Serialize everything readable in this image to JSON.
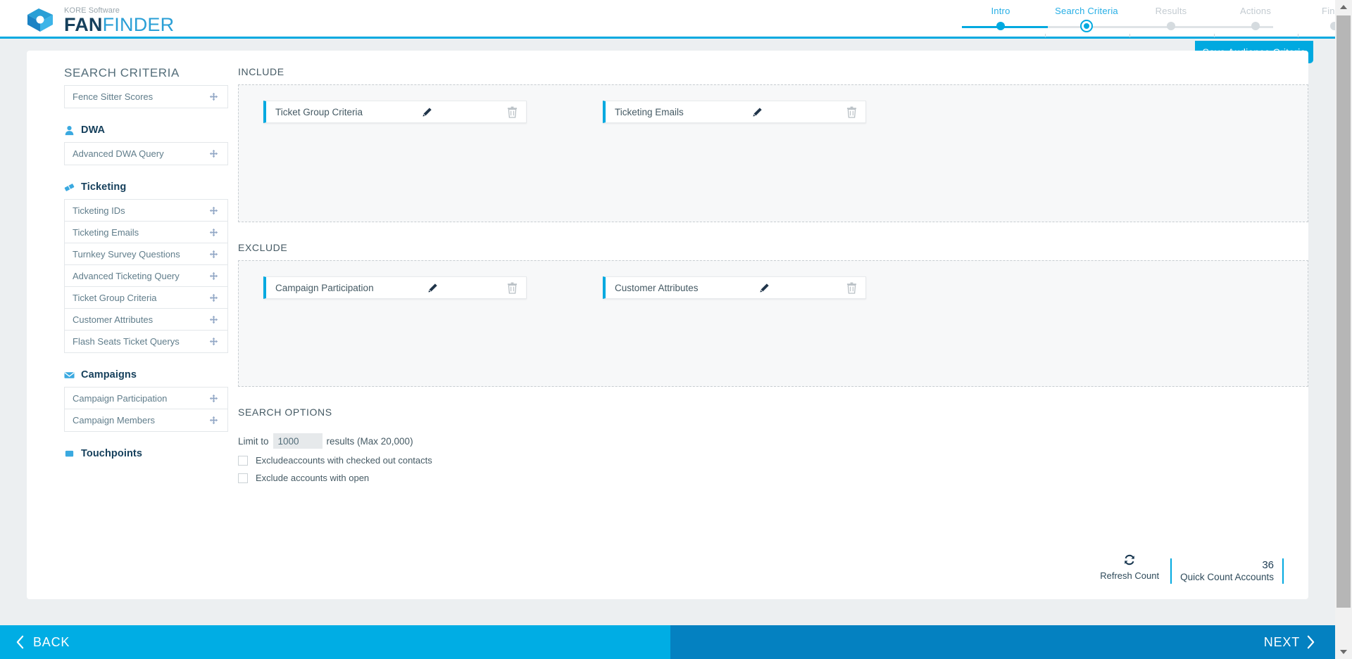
{
  "brand": {
    "sub": "KORE Software",
    "name_bold": "FAN",
    "name_light": "FINDER",
    "logo_icon": "kore-cube-logo"
  },
  "header": {
    "save_button": "Save Audience Criteria"
  },
  "stepper": {
    "steps": [
      {
        "label": "Intro",
        "state": "done"
      },
      {
        "label": "Search Criteria",
        "state": "current"
      },
      {
        "label": "Results",
        "state": "todo"
      },
      {
        "label": "Actions",
        "state": "todo"
      },
      {
        "label": "Finish",
        "state": "todo"
      }
    ],
    "accent_color": "#00a9e0",
    "inactive_color": "#d5dbdf"
  },
  "sidebar": {
    "title": "SEARCH CRITERIA",
    "groups": [
      {
        "name": "",
        "icon": "",
        "items": [
          {
            "label": "Fence Sitter Scores",
            "drag_icon": "move-arrows-icon"
          }
        ]
      },
      {
        "name": "DWA",
        "icon": "person-icon",
        "items": [
          {
            "label": "Advanced DWA Query",
            "drag_icon": "move-arrows-icon"
          }
        ]
      },
      {
        "name": "Ticketing",
        "icon": "ticket-icon",
        "items": [
          {
            "label": "Ticketing IDs",
            "drag_icon": "move-arrows-icon"
          },
          {
            "label": "Ticketing Emails",
            "drag_icon": "move-arrows-icon"
          },
          {
            "label": "Turnkey Survey Questions",
            "drag_icon": "move-arrows-icon"
          },
          {
            "label": "Advanced Ticketing Query",
            "drag_icon": "move-arrows-icon"
          },
          {
            "label": "Ticket Group Criteria",
            "drag_icon": "move-arrows-icon"
          },
          {
            "label": "Customer Attributes",
            "drag_icon": "move-arrows-icon"
          },
          {
            "label": "Flash Seats Ticket Querys",
            "drag_icon": "move-arrows-icon"
          }
        ]
      },
      {
        "name": "Campaigns",
        "icon": "envelope-icon",
        "items": [
          {
            "label": "Campaign Participation",
            "drag_icon": "move-arrows-icon"
          },
          {
            "label": "Campaign Members",
            "drag_icon": "move-arrows-icon"
          }
        ]
      },
      {
        "name": "Touchpoints",
        "icon": "touchpoint-icon",
        "items": [],
        "clipped": true
      }
    ]
  },
  "include": {
    "title": "INCLUDE",
    "chips": [
      {
        "label": "Ticket Group Criteria",
        "edit_icon": "pencil-icon",
        "delete_icon": "trash-icon"
      },
      {
        "label": "Ticketing Emails",
        "edit_icon": "pencil-icon",
        "delete_icon": "trash-icon"
      }
    ]
  },
  "exclude": {
    "title": "EXCLUDE",
    "chips": [
      {
        "label": "Campaign Participation",
        "edit_icon": "pencil-icon",
        "delete_icon": "trash-icon"
      },
      {
        "label": "Customer Attributes",
        "edit_icon": "pencil-icon",
        "delete_icon": "trash-icon"
      }
    ]
  },
  "search_options": {
    "title": "SEARCH OPTIONS",
    "limit_prefix": "Limit to",
    "limit_value": "1000",
    "limit_placeholder": "1000",
    "limit_suffix": "results (Max 20,000)",
    "checkboxes": [
      {
        "label": "Excludeaccounts with checked out contacts",
        "checked": false
      },
      {
        "label": "Exclude accounts with open",
        "checked": false
      }
    ]
  },
  "count": {
    "refresh_icon": "refresh-icon",
    "refresh_label": "Refresh Count",
    "value": "36",
    "label": "Quick Count Accounts",
    "accent_color": "#00a9e0"
  },
  "nav": {
    "back_label": "BACK",
    "back_icon": "chevron-left-icon",
    "back_color": "#00ade4",
    "next_label": "NEXT",
    "next_icon": "chevron-right-icon",
    "next_color": "#0481c1"
  }
}
